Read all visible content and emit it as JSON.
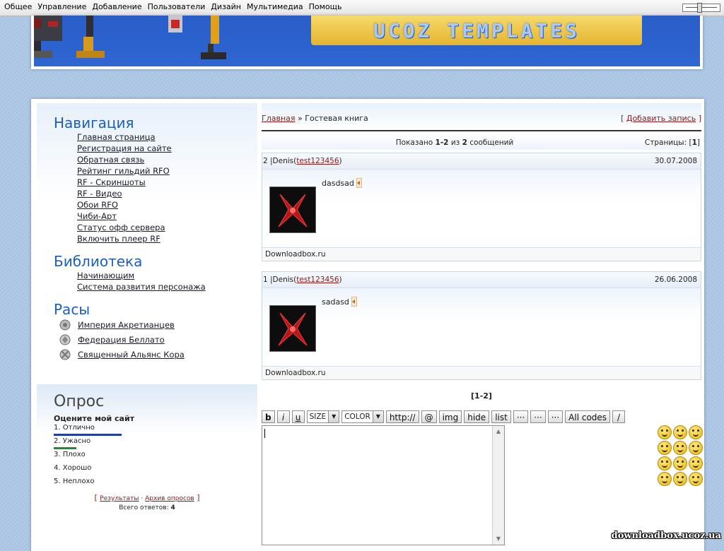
{
  "topbar": {
    "menu": [
      "Общее",
      "Управление",
      "Добавление",
      "Пользователи",
      "Дизайн",
      "Мультимедиа",
      "Помощь"
    ]
  },
  "header": {
    "logo_text": "UCOZ TEMPLATES"
  },
  "sidebar": {
    "nav_title": "Навигация",
    "nav_items": [
      "Главная страница",
      "Регистрация на сайте",
      "Обратная связь",
      "Рейтинг гильдий RFO",
      "RF - Скриншоты",
      "RF - Видео",
      "Обои RFO",
      "Чиби-Арт",
      "Статус офф сервера",
      "Включить плеер RF"
    ],
    "library_title": "Библиотека",
    "library_items": [
      "Начинающим",
      "Система развития персонажа"
    ],
    "races_title": "Расы",
    "races": [
      "Империя Акретианцев",
      "Федерация Беллато",
      "Священный Альянс Кора"
    ]
  },
  "poll": {
    "title": "Опрос",
    "question": "Оцените мой сайт",
    "options": [
      {
        "label": "1. Отлично",
        "color": "#1c3fa8",
        "share": 1.0
      },
      {
        "label": "2. Ужасно",
        "color": "#1c8f2a",
        "share": 0.33
      },
      {
        "label": "3. Плохо",
        "share": 0
      },
      {
        "label": "4. Хорошо",
        "share": 0
      },
      {
        "label": "5. Неплохо",
        "share": 0
      }
    ],
    "results_link": "Результаты",
    "separator": "·",
    "archive_link": "Архив опросов",
    "total_label": "Всего ответов:",
    "total_value": "4"
  },
  "content": {
    "breadcrumb_home": "Главная",
    "breadcrumb_sep": "»",
    "breadcrumb_current": "Гостевая книга",
    "add_entry": "Добавить запись",
    "shown_prefix": "Показано",
    "shown_range": "1-2",
    "shown_mid": "из",
    "shown_total": "2",
    "shown_suffix": "сообщений",
    "pages_label": "Страницы:",
    "pages_value": "1",
    "entries": [
      {
        "num_user": "2 |Denis",
        "login": "test123456",
        "date": "30.07.2008",
        "message": "dasdsad",
        "footer": "Downloadbox.ru"
      },
      {
        "num_user": "1 |Denis",
        "login": "test123456",
        "date": "26.06.2008",
        "message": "sadasd",
        "footer": "Downloadbox.ru"
      }
    ],
    "pager": "[1-2]"
  },
  "editor": {
    "buttons": {
      "bold": "b",
      "italic": "i",
      "underline": "u",
      "size": "SIZE",
      "color": "COLOR",
      "http": "http://",
      "email": "@",
      "img": "img",
      "hide": "hide",
      "list": "list",
      "more1": "···",
      "more2": "···",
      "more3": "···",
      "all_codes": "All codes",
      "close": "/"
    }
  },
  "watermark": "downloadbox.ucoz.ua"
}
